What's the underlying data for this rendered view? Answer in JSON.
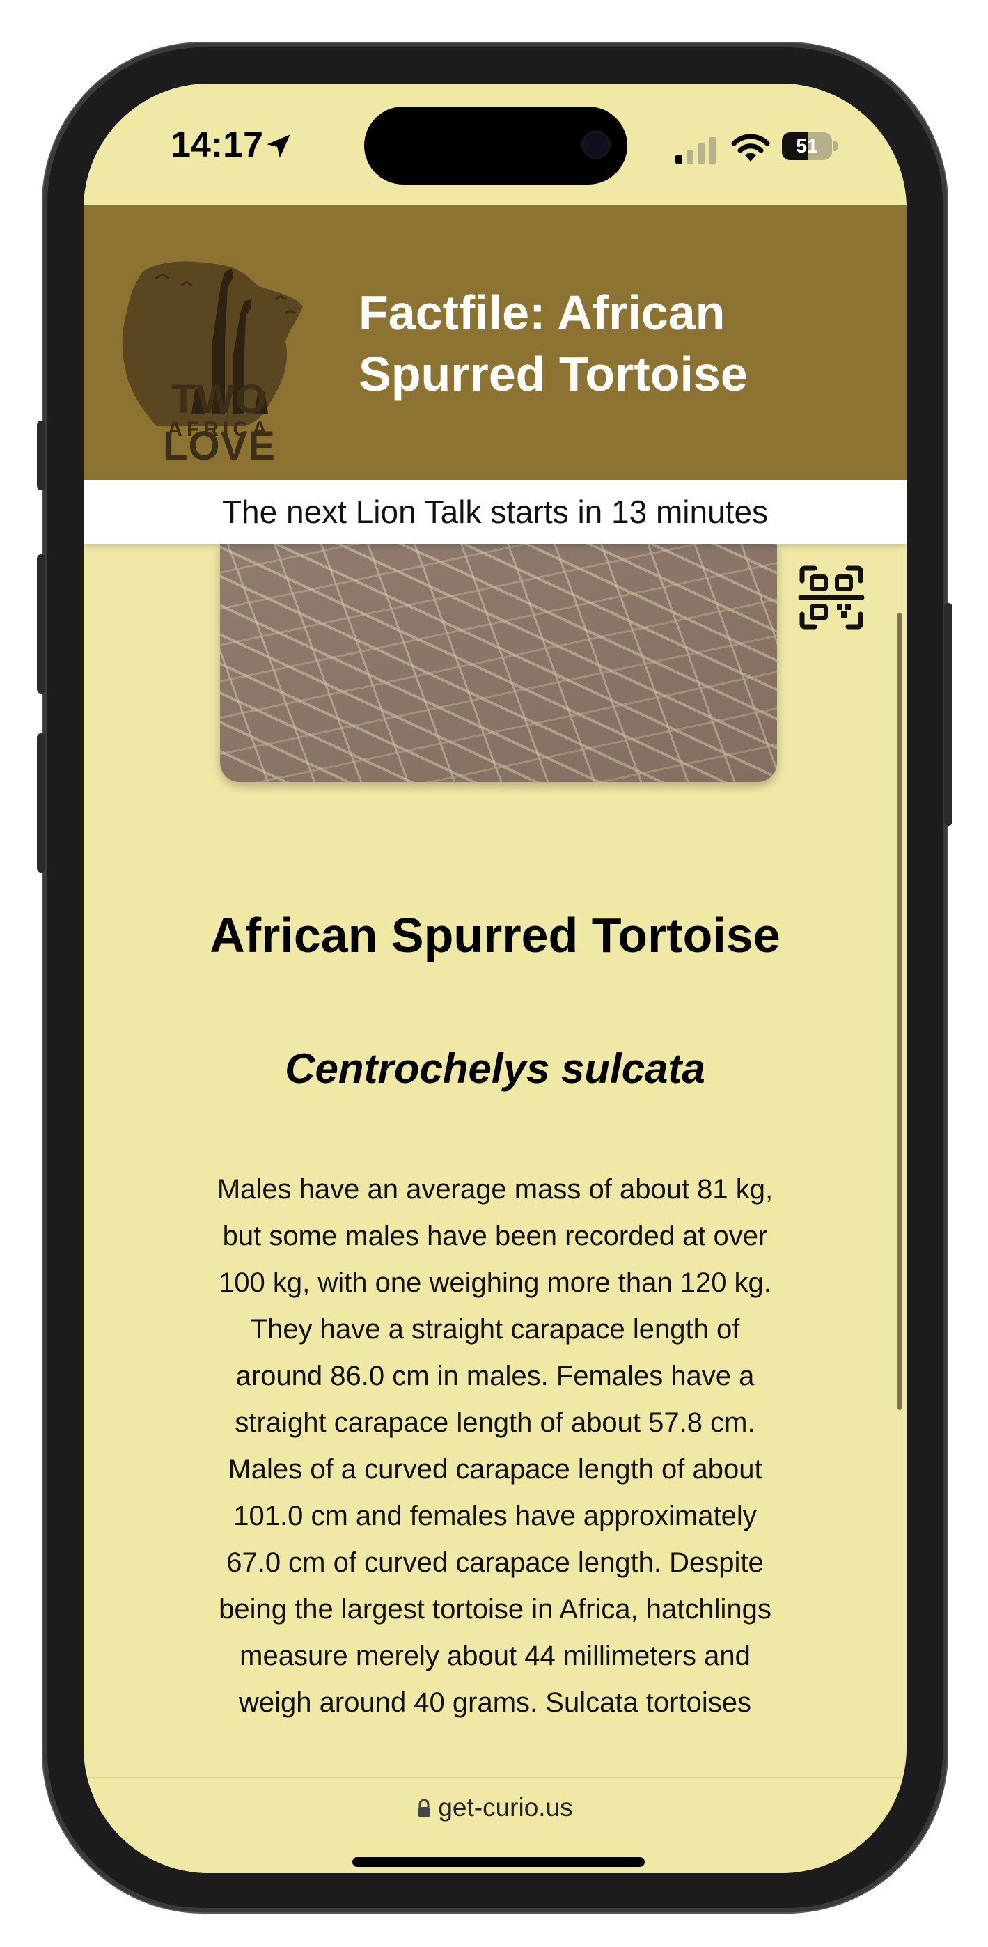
{
  "status_bar": {
    "time": "14:17",
    "battery": "51",
    "battery_level": 0.51
  },
  "header": {
    "logo_text": "TWO LOVE",
    "logo_subtext": "AFRICA",
    "title": "Factfile: African Spurred Tortoise"
  },
  "banner": {
    "text": "The next Lion Talk starts in 13 minutes"
  },
  "animal": {
    "name": "African Spurred Tortoise",
    "scientific_name": "Centrochelys sulcata",
    "description": "Males have an average mass of about 81 kg, but some males have been recorded at over 100 kg, with one weighing more than 120 kg. They have a straight carapace length of around 86.0 cm in males. Females have a straight carapace length of about 57.8 cm. Males of a curved carapace length of about 101.0 cm and females have approximately 67.0 cm of curved carapace length. Despite being the largest tortoise in Africa, hatchlings measure merely about 44 millimeters and weigh around 40 grams. Sulcata tortoises"
  },
  "browser": {
    "url": "get-curio.us"
  },
  "icons": {
    "qr": "qr-code-icon",
    "lock": "lock-icon",
    "location": "location-arrow-icon"
  },
  "colors": {
    "background": "#f0e9a6",
    "header": "#8d7332",
    "banner": "#ffffff"
  }
}
